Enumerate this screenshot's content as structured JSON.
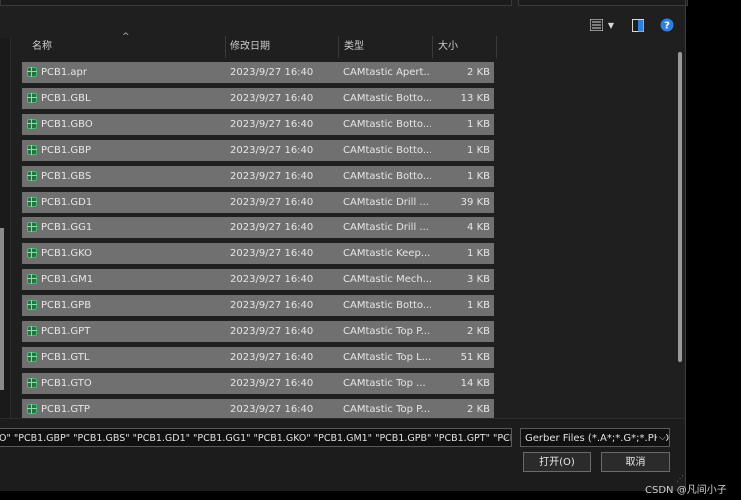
{
  "columns": {
    "name": "名称",
    "date": "修改日期",
    "type": "类型",
    "size": "大小"
  },
  "files": [
    {
      "name": "PCB1.apr",
      "date": "2023/9/27 16:40",
      "type": "CAMtastic Apert...",
      "size": "2 KB"
    },
    {
      "name": "PCB1.GBL",
      "date": "2023/9/27 16:40",
      "type": "CAMtastic Botto...",
      "size": "13 KB"
    },
    {
      "name": "PCB1.GBO",
      "date": "2023/9/27 16:40",
      "type": "CAMtastic Botto...",
      "size": "1 KB"
    },
    {
      "name": "PCB1.GBP",
      "date": "2023/9/27 16:40",
      "type": "CAMtastic Botto...",
      "size": "1 KB"
    },
    {
      "name": "PCB1.GBS",
      "date": "2023/9/27 16:40",
      "type": "CAMtastic Botto...",
      "size": "1 KB"
    },
    {
      "name": "PCB1.GD1",
      "date": "2023/9/27 16:40",
      "type": "CAMtastic Drill ...",
      "size": "39 KB"
    },
    {
      "name": "PCB1.GG1",
      "date": "2023/9/27 16:40",
      "type": "CAMtastic Drill ...",
      "size": "4 KB"
    },
    {
      "name": "PCB1.GKO",
      "date": "2023/9/27 16:40",
      "type": "CAMtastic Keep...",
      "size": "1 KB"
    },
    {
      "name": "PCB1.GM1",
      "date": "2023/9/27 16:40",
      "type": "CAMtastic Mech...",
      "size": "3 KB"
    },
    {
      "name": "PCB1.GPB",
      "date": "2023/9/27 16:40",
      "type": "CAMtastic Botto...",
      "size": "1 KB"
    },
    {
      "name": "PCB1.GPT",
      "date": "2023/9/27 16:40",
      "type": "CAMtastic Top P...",
      "size": "2 KB"
    },
    {
      "name": "PCB1.GTL",
      "date": "2023/9/27 16:40",
      "type": "CAMtastic Top L...",
      "size": "51 KB"
    },
    {
      "name": "PCB1.GTO",
      "date": "2023/9/27 16:40",
      "type": "CAMtastic Top ...",
      "size": "14 KB"
    },
    {
      "name": "PCB1.GTP",
      "date": "2023/9/27 16:40",
      "type": "CAMtastic Top P...",
      "size": "2 KB"
    }
  ],
  "filename_value": "O\" \"PCB1.GBP\" \"PCB1.GBS\" \"PCB1.GD1\" \"PCB1.GG1\" \"PCB1.GKO\" \"PCB1.GM1\" \"PCB1.GPB\" \"PCB1.GPT\" \"PCB1",
  "file_type_filter": "Gerber Files (*.A*;*.G*;*.PHO",
  "buttons": {
    "open": "打开(O)",
    "cancel": "取消"
  },
  "toolbar_icons": [
    "view-details-icon",
    "chevron-down-icon",
    "preview-pane-icon",
    "help-icon"
  ],
  "help_glyph": "?",
  "watermark": "CSDN @凡间小子",
  "colors": {
    "dialog_bg": "#1f1f1f",
    "row_selected": "#707070",
    "file_icon": "#3fbf6e",
    "help_blue": "#2f7fe0"
  }
}
